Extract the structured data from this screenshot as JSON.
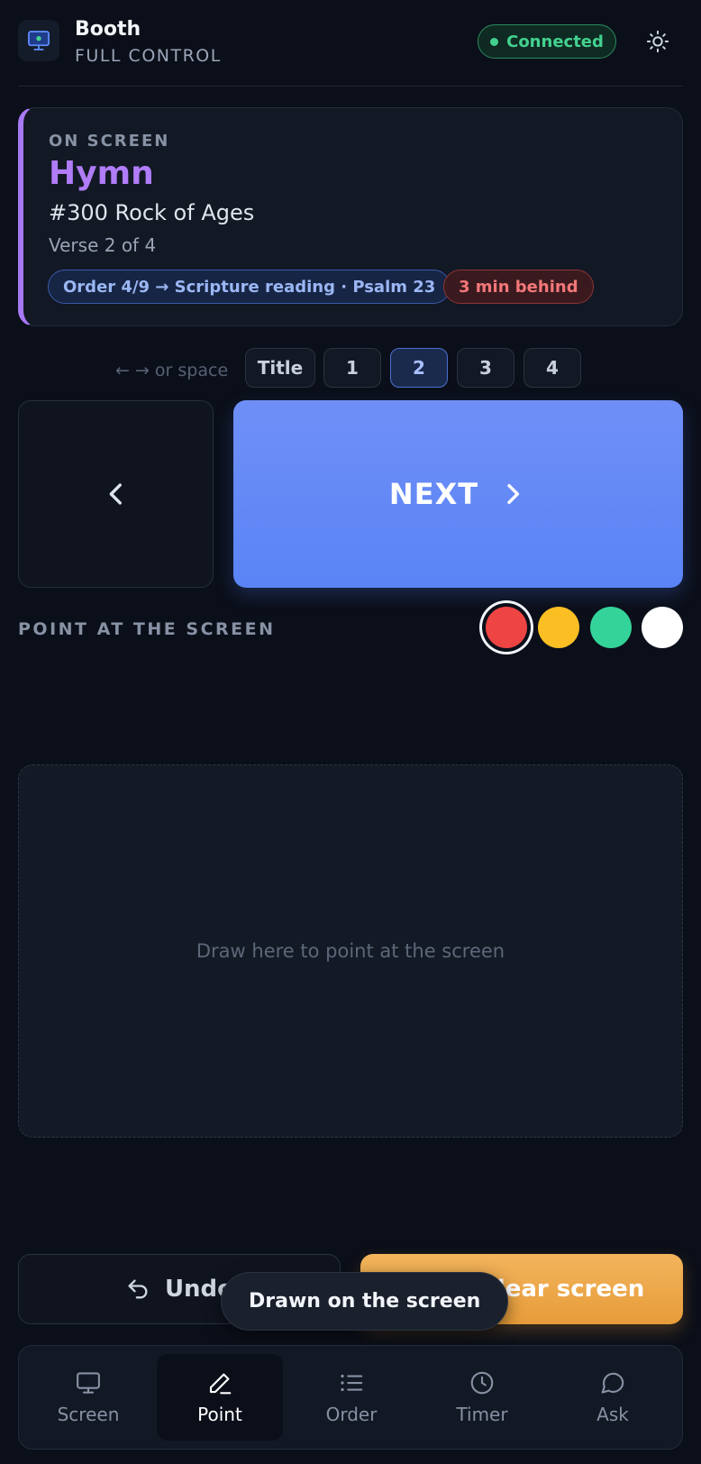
{
  "header": {
    "app_name": "Booth",
    "mode": "FULL CONTROL",
    "status": "Connected",
    "app_icon": "monitor-icon",
    "theme_icon": "sun-icon"
  },
  "now_showing": {
    "eyebrow": "ON SCREEN",
    "type": "Hymn",
    "item": "#300 Rock of Ages",
    "verse": "Verse 2 of 4",
    "order_tag": "Order 4/9 → Scripture reading · Psalm 23",
    "behind_tag": "3 min behind"
  },
  "slides": {
    "hint": "← → or space",
    "items": [
      "Title",
      "1",
      "2",
      "3",
      "4"
    ],
    "active": "2"
  },
  "nav": {
    "next_label": "NEXT",
    "prev_icon": "chevron-left-icon",
    "next_icon": "chevron-right-icon"
  },
  "pointer": {
    "heading": "POINT AT THE SCREEN",
    "colors": [
      "#ef4444",
      "#fbbf24",
      "#34d399",
      "#ffffff"
    ],
    "selected_color": "#ef4444",
    "placeholder": "Draw here to point at the screen"
  },
  "actions": {
    "undo_label": "Undo",
    "clear_label": "Clear screen",
    "toast": "Drawn on the screen"
  },
  "tabs": [
    {
      "label": "Screen",
      "icon": "monitor-icon"
    },
    {
      "label": "Point",
      "icon": "pen-icon"
    },
    {
      "label": "Order",
      "icon": "list-icon"
    },
    {
      "label": "Timer",
      "icon": "clock-icon"
    },
    {
      "label": "Ask",
      "icon": "chat-bubble-icon"
    }
  ],
  "active_tab": "Point",
  "colors": {
    "accent_purple": "#a879f7",
    "next_blue": "#5a84f5",
    "clear_orange": "#e79c3a",
    "connected_green": "#43d18f",
    "behind_red": "#f4777a"
  }
}
